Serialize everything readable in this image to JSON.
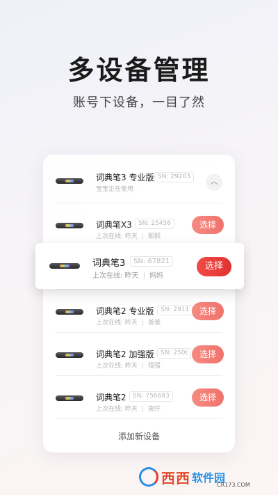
{
  "hero": {
    "title": "多设备管理",
    "subtitle": "账号下设备，一目了然"
  },
  "devices": [
    {
      "name": "词典笔3 专业版",
      "sn": "SN: 29203",
      "status": "宝宝正在使用",
      "action": "collapse"
    },
    {
      "name": "词典笔X3",
      "sn": "SN: 25456",
      "last_online": "上次在线: 昨天",
      "owner": "熙熙",
      "select_label": "选择"
    },
    {
      "name": "词典笔3",
      "sn": "SN: 67821",
      "last_online": "上次在线: 昨天",
      "owner": "妈妈",
      "select_label": "选择"
    },
    {
      "name": "词典笔2 专业版",
      "sn": "SN: 2911",
      "last_online": "上次在线: 昨天",
      "owner": "爸爸",
      "select_label": "选择"
    },
    {
      "name": "词典笔2 加强版",
      "sn": "SN: 250t",
      "last_online": "上次在线: 昨天",
      "owner": "强强",
      "select_label": "选择"
    },
    {
      "name": "词典笔2",
      "sn": "SN: 756683",
      "last_online": "上次在线: 昨天",
      "owner": "崽仔",
      "select_label": "选择"
    }
  ],
  "add_device_label": "添加新设备",
  "watermark": {
    "brand": "西西",
    "name": "软件园",
    "url": "CR173.COM"
  },
  "colors": {
    "select_button": "#f0726c",
    "select_button_active": "#e2322f"
  }
}
